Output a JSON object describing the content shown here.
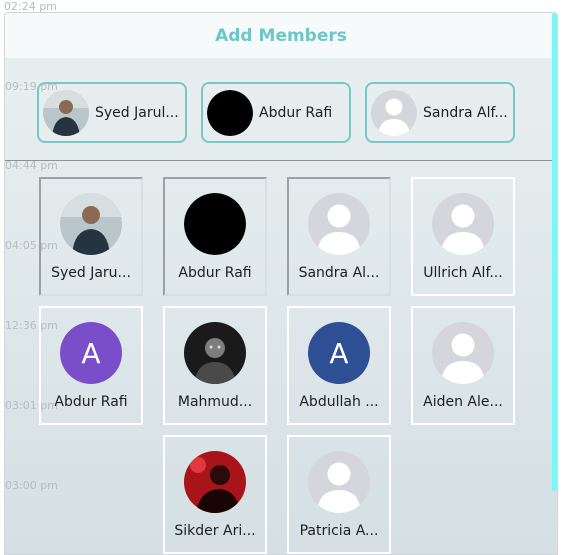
{
  "background_timestamps": [
    "02:24 pm",
    "09:19 pm",
    "04:44 pm",
    "04:05 pm",
    "12:36 pm",
    "03:01 pm",
    "03:00 pm"
  ],
  "dialog": {
    "title": "Add Members"
  },
  "selected_members": [
    {
      "name": "Syed Jarul...",
      "avatar": "photo-man-icon"
    },
    {
      "name": "Abdur Rafi",
      "avatar": "black-avatar-icon"
    },
    {
      "name": "Sandra Alf...",
      "avatar": "default-user-icon"
    }
  ],
  "members": [
    {
      "name": "Syed Jaru...",
      "avatar": "photo-man-icon",
      "selected": true
    },
    {
      "name": "Abdur Rafi",
      "avatar": "black-avatar-icon",
      "selected": true
    },
    {
      "name": "Sandra Al...",
      "avatar": "default-user-icon",
      "selected": true
    },
    {
      "name": "Ullrich Alf...",
      "avatar": "default-user-icon",
      "selected": false
    },
    {
      "name": "Abdur Rafi",
      "avatar": "letter-avatar-icon",
      "initial": "A",
      "color": "#7a4ec8",
      "selected": false
    },
    {
      "name": "Mahmud...",
      "avatar": "photo-mono-icon",
      "selected": false
    },
    {
      "name": "Abdullah ...",
      "avatar": "letter-avatar-icon",
      "initial": "A",
      "color": "#2f4f94",
      "selected": false
    },
    {
      "name": "Aiden Ale...",
      "avatar": "default-user-icon",
      "selected": false
    },
    {
      "name": "Sikder Ari...",
      "avatar": "photo-red-icon",
      "selected": false
    },
    {
      "name": "Patricia A...",
      "avatar": "default-user-icon",
      "selected": false
    }
  ],
  "colors": {
    "accent": "#6fc6c8",
    "chip_border": "#7ac7c9",
    "scrollbar": "#7cf7f7"
  }
}
